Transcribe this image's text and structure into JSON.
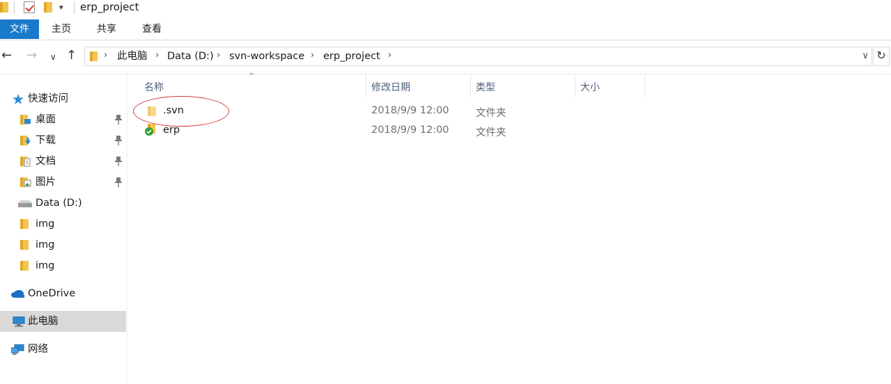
{
  "window": {
    "title": "erp_project"
  },
  "ribbon": {
    "tabs": [
      "文件",
      "主页",
      "共享",
      "查看"
    ]
  },
  "address": {
    "crumbs": [
      "此电脑",
      "Data (D:)",
      "svn-workspace",
      "erp_project"
    ]
  },
  "sidebar": {
    "quick_access": "快速访问",
    "pinned": [
      "桌面",
      "下载",
      "文档",
      "图片"
    ],
    "drive": "Data (D:)",
    "folders": [
      "img",
      "img",
      "img"
    ],
    "onedrive": "OneDrive",
    "this_pc": "此电脑",
    "network": "网络"
  },
  "columns": {
    "name": "名称",
    "modified": "修改日期",
    "type": "类型",
    "size": "大小"
  },
  "files": [
    {
      "name": ".svn",
      "modified": "2018/9/9 12:00",
      "type": "文件夹",
      "icon": "folder-icon"
    },
    {
      "name": "erp",
      "modified": "2018/9/9 12:00",
      "type": "文件夹",
      "icon": "svn-normal-folder-icon"
    }
  ],
  "colors": {
    "accent": "#1979ca",
    "annotation": "#d63c3c",
    "folder": "#f3c44e",
    "svn_ok": "#2ea02e"
  }
}
